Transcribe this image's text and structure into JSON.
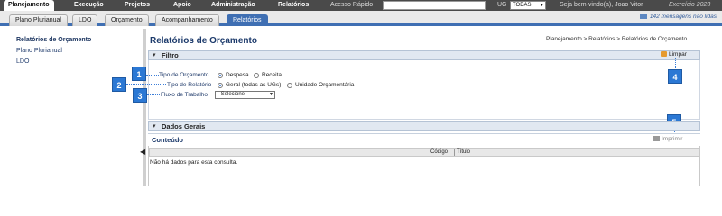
{
  "topbar": {
    "nav": [
      "Planejamento",
      "Execução",
      "Projetos",
      "Apoio",
      "Administração",
      "Relatórios"
    ],
    "quick_access_label": "Acesso Rápido",
    "ug_label": "UG",
    "ug_selected": "TODAS",
    "welcome": "Seja bem-vindo(a), Joao Vitor",
    "year": "Exercício 2023"
  },
  "subtabs": [
    "Plano Plurianual",
    "LDO",
    "Orçamento",
    "Acompanhamento",
    "Relatórios"
  ],
  "messages": "142 mensagens não lidas",
  "sidebar": {
    "items": [
      "Relatórios de Orçamento",
      "Plano Plurianual",
      "LDO"
    ]
  },
  "page": {
    "title": "Relatórios de Orçamento",
    "breadcrumb": "Planejamento > Relatórios > Relatórios de Orçamento"
  },
  "filtro": {
    "header": "Filtro",
    "clear_label": "Limpar",
    "tipo_orcamento": {
      "label": "Tipo de Orçamento",
      "options": [
        "Despesa",
        "Receita"
      ],
      "selected": "Despesa"
    },
    "tipo_relatorio": {
      "label": "Tipo de Relatório",
      "options": [
        "Geral (todas as UGs)",
        "Unidade Orçamentária"
      ],
      "selected": "Geral (todas as UGs)"
    },
    "fluxo": {
      "label": "Fluxo de Trabalho",
      "selected": "- Selecione -"
    }
  },
  "dados_gerais": {
    "header": "Dados Gerais"
  },
  "conteudo": {
    "title": "Conteúdo",
    "print_label": "Imprimir",
    "columns": [
      "Código",
      "Título"
    ],
    "empty_message": "Não há dados para esta consulta."
  },
  "badges": [
    "1",
    "2",
    "3",
    "4",
    "5"
  ],
  "colors": {
    "accent": "#2b78d4",
    "topbar": "#4a4a4a",
    "tab_active": "#3f6fb3"
  }
}
